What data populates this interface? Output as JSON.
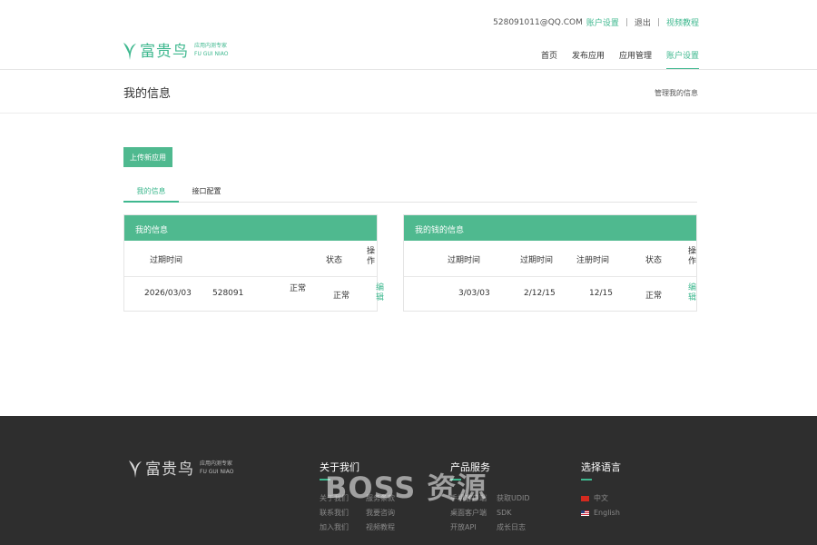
{
  "header": {
    "account_email": "528091011@QQ.COM",
    "account_settings_link": "账户设置",
    "logout": "退出",
    "video_tutorial": "视频教程",
    "logo_name": "富贵鸟",
    "logo_tagline": "应用内测专家",
    "logo_pinyin": "FU GUI NIAO",
    "nav": [
      {
        "label": "首页",
        "active": false
      },
      {
        "label": "发布应用",
        "active": false
      },
      {
        "label": "应用管理",
        "active": false
      },
      {
        "label": "账户设置",
        "active": true
      }
    ]
  },
  "page": {
    "title": "我的信息",
    "breadcrumb": "管理我的信息",
    "upload_button": "上传新应用",
    "tabs": [
      {
        "label": "我的信息",
        "active": true
      },
      {
        "label": "接口配置",
        "active": false
      }
    ]
  },
  "panel_left": {
    "title": "我的信息",
    "headers": [
      "过期时间",
      "状态",
      "操作"
    ],
    "row": {
      "expire": "2026/03/03",
      "id": "528091",
      "status1": "正常",
      "status2": "正常",
      "action": "编辑"
    }
  },
  "panel_right": {
    "title": "我的钱的信息",
    "headers": [
      "过期时间",
      "过期时间",
      "注册时间",
      "状态",
      "操作"
    ],
    "row": {
      "c1": "3/03/03",
      "c2": "2/12/15",
      "c3": "12/15",
      "status": "正常",
      "action": "编辑"
    }
  },
  "footer": {
    "logo_name": "富贵鸟",
    "logo_tagline": "应用内测专家",
    "logo_pinyin": "FU GUI NIAO",
    "about": {
      "title": "关于我们",
      "links": [
        "关于我们",
        "服务条款",
        "联系我们",
        "我要咨询",
        "加入我们",
        "视频教程"
      ]
    },
    "products": {
      "title": "产品服务",
      "links": [
        "手机客户端",
        "获取UDID",
        "桌面客户端",
        "SDK",
        "开放API",
        "成长日志"
      ]
    },
    "language": {
      "title": "选择语言",
      "options": [
        {
          "label": "中文",
          "flag": "cn-flag-icon"
        },
        {
          "label": "English",
          "flag": "us-flag-icon"
        }
      ]
    },
    "watermark": "BOSS 资源"
  },
  "colors": {
    "accent": "#4fb98f",
    "footer_bg": "#2e2e2e"
  }
}
